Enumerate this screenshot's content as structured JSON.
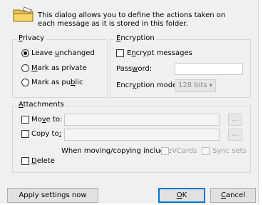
{
  "header": {
    "description": "This dialog allows you to define the actions taken on each message as it is stored in this folder.",
    "icon": "folder-icon"
  },
  "privacy": {
    "title": "Privacy",
    "options": [
      {
        "label": "Leave unchanged",
        "selected": true
      },
      {
        "label": "Mark as private",
        "selected": false
      },
      {
        "label": "Mark as public",
        "selected": false
      }
    ]
  },
  "encryption": {
    "title": "Encryption",
    "encrypt_label": "Encrypt messages",
    "encrypt_checked": false,
    "password_label": "Password:",
    "password_value": "",
    "mode_label": "Encryption mode:",
    "mode_value": "128 bits"
  },
  "attachments": {
    "title": "Attachments",
    "move_label": "Move to:",
    "move_value": "",
    "move_browse": "...",
    "copy_label": "Copy to:",
    "copy_value": "",
    "copy_browse": "...",
    "include_label": "When moving/copying include:",
    "vcards_label": "VCards",
    "sync_sets_label": "Sync sets",
    "delete_label": "Delete"
  },
  "buttons": {
    "apply": "Apply settings now",
    "ok": "OK",
    "cancel": "Cancel"
  },
  "colors": {
    "background": "#f0f0f0",
    "accent": "#0078d7",
    "folder": "#f5d565"
  }
}
